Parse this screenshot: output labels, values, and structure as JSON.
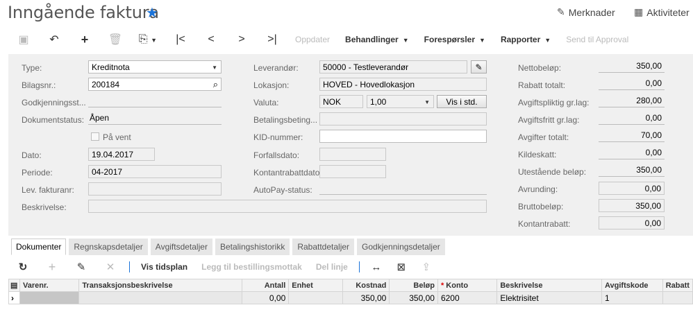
{
  "header": {
    "title": "Inngående faktura",
    "notes_label": "Merknader",
    "activities_label": "Aktiviteter"
  },
  "toolbar": {
    "update_label": "Oppdater",
    "actions_label": "Behandlinger",
    "inquiries_label": "Forespørsler",
    "reports_label": "Rapporter",
    "send_approval_label": "Send til Approval"
  },
  "form": {
    "type": {
      "label": "Type:",
      "value": "Kreditnota"
    },
    "doc_no": {
      "label": "Bilagsnr.:",
      "value": "200184"
    },
    "approval": {
      "label": "Godkjenningsst...",
      "value": ""
    },
    "doc_status": {
      "label": "Dokumentstatus:",
      "value": "Åpen"
    },
    "on_hold": {
      "label": "På vent",
      "checked": false
    },
    "date": {
      "label": "Dato:",
      "value": "19.04.2017"
    },
    "period": {
      "label": "Periode:",
      "value": "04-2017"
    },
    "vendor_invoice_no": {
      "label": "Lev. fakturanr:",
      "value": ""
    },
    "description": {
      "label": "Beskrivelse:",
      "value": ""
    },
    "vendor": {
      "label": "Leverandør:",
      "value": "50000 - Testleverandør"
    },
    "location": {
      "label": "Lokasjon:",
      "value": "HOVED - Hovedlokasjon"
    },
    "currency": {
      "label": "Valuta:",
      "value": "NOK",
      "rate": "1,00",
      "button": "Vis i std."
    },
    "payment_terms": {
      "label": "Betalingsbeting...",
      "value": ""
    },
    "kid": {
      "label": "KID-nummer:",
      "value": ""
    },
    "due_date": {
      "label": "Forfallsdato:",
      "value": ""
    },
    "cash_discount_date": {
      "label": "Kontantrabattdato:",
      "value": ""
    },
    "autopay": {
      "label": "AutoPay-status:",
      "value": ""
    }
  },
  "totals": [
    {
      "label": "Nettobeløp:",
      "value": "350,00",
      "boxed": false
    },
    {
      "label": "Rabatt totalt:",
      "value": "0,00",
      "boxed": false
    },
    {
      "label": "Avgiftspliktig gr.lag:",
      "value": "280,00",
      "boxed": false
    },
    {
      "label": "Avgiftsfritt gr.lag:",
      "value": "0,00",
      "boxed": false
    },
    {
      "label": "Avgifter totalt:",
      "value": "70,00",
      "boxed": false
    },
    {
      "label": "Kildeskatt:",
      "value": "0,00",
      "boxed": false
    },
    {
      "label": "Utestående beløp:",
      "value": "350,00",
      "boxed": false
    },
    {
      "label": "Avrunding:",
      "value": "0,00",
      "boxed": true
    },
    {
      "label": "Bruttobeløp:",
      "value": "350,00",
      "boxed": true
    },
    {
      "label": "Kontantrabatt:",
      "value": "0,00",
      "boxed": true
    }
  ],
  "tabs": [
    "Dokumenter",
    "Regnskapsdetaljer",
    "Avgiftsdetaljer",
    "Betalingshistorikk",
    "Rabattdetaljer",
    "Godkjenningsdetaljer"
  ],
  "grid_toolbar": {
    "schedule_label": "Vis tidsplan",
    "add_receipt_label": "Legg til bestillingsmottak",
    "delete_line_label": "Del linje"
  },
  "grid": {
    "columns": [
      "Varenr.",
      "Transaksjonsbeskrivelse",
      "Antall",
      "Enhet",
      "Kostnad",
      "Beløp",
      "Konto",
      "Beskrivelse",
      "Avgiftskode",
      "Rabatt"
    ],
    "rows": [
      {
        "item": "",
        "trans_desc": "",
        "qty": "0,00",
        "unit": "",
        "cost": "350,00",
        "amount": "350,00",
        "account": "6200",
        "description": "Elektrisitet",
        "tax_code": "1",
        "discount": ""
      }
    ]
  },
  "icons": {
    "star": "star-icon",
    "notes": "edit-note-icon",
    "activities": "calendar-icon"
  },
  "colors": {
    "accent": "#1a73d9"
  }
}
